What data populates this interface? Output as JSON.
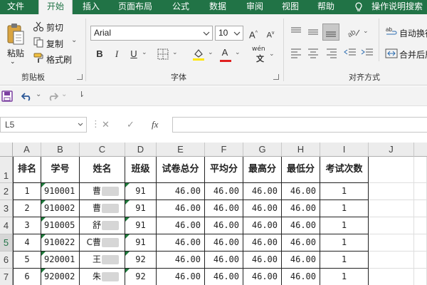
{
  "ribbon_tabs": [
    "文件",
    "开始",
    "插入",
    "页面布局",
    "公式",
    "数据",
    "审阅",
    "视图",
    "帮助",
    "操作说明搜索"
  ],
  "active_tab": "开始",
  "clipboard": {
    "paste": "粘贴",
    "cut": "剪切",
    "copy": "复制",
    "format_painter": "格式刷",
    "group_label": "剪贴板"
  },
  "font": {
    "name": "Arial",
    "size": "10",
    "group_label": "字体",
    "bold": "B",
    "italic": "I",
    "underline": "U",
    "grow": "A",
    "shrink": "A",
    "wen": "wén",
    "font_color_letter": "A",
    "fill_color": "#FFE600",
    "font_color": "#E02020"
  },
  "alignment": {
    "wrap_text": "自动换行",
    "merge_center": "合并后居",
    "group_label": "对齐方式"
  },
  "formula_bar": {
    "name_box": "L5",
    "cancel": "✕",
    "enter": "✓",
    "fx": "fx",
    "content": ""
  },
  "sheet": {
    "columns": [
      "A",
      "B",
      "C",
      "D",
      "E",
      "F",
      "G",
      "H",
      "I",
      "J"
    ],
    "rows": [
      "1",
      "2",
      "3",
      "4",
      "5",
      "6",
      "7"
    ],
    "selected_row": "5",
    "header": [
      "排名",
      "学号",
      "姓名",
      "班级",
      "试卷总分",
      "平均分",
      "最高分",
      "最低分",
      "考试次数"
    ],
    "data": [
      {
        "rank": "1",
        "id": "910001",
        "name": "曹",
        "class": "91",
        "total": "46.00",
        "avg": "46.00",
        "max": "46.00",
        "min": "46.00",
        "count": "1"
      },
      {
        "rank": "2",
        "id": "910002",
        "name": "曹",
        "class": "91",
        "total": "46.00",
        "avg": "46.00",
        "max": "46.00",
        "min": "46.00",
        "count": "1"
      },
      {
        "rank": "3",
        "id": "910005",
        "name": "舒",
        "class": "91",
        "total": "46.00",
        "avg": "46.00",
        "max": "46.00",
        "min": "46.00",
        "count": "1"
      },
      {
        "rank": "4",
        "id": "910022",
        "name": "C曹",
        "class": "91",
        "total": "46.00",
        "avg": "46.00",
        "max": "46.00",
        "min": "46.00",
        "count": "1"
      },
      {
        "rank": "5",
        "id": "920001",
        "name": "王",
        "class": "92",
        "total": "46.00",
        "avg": "46.00",
        "max": "46.00",
        "min": "46.00",
        "count": "1"
      },
      {
        "rank": "6",
        "id": "920002",
        "name": "朱",
        "class": "92",
        "total": "46.00",
        "avg": "46.00",
        "max": "46.00",
        "min": "46.00",
        "count": "1"
      }
    ]
  },
  "colors": {
    "brand": "#217346",
    "error_marker": "#1E7B3B"
  }
}
